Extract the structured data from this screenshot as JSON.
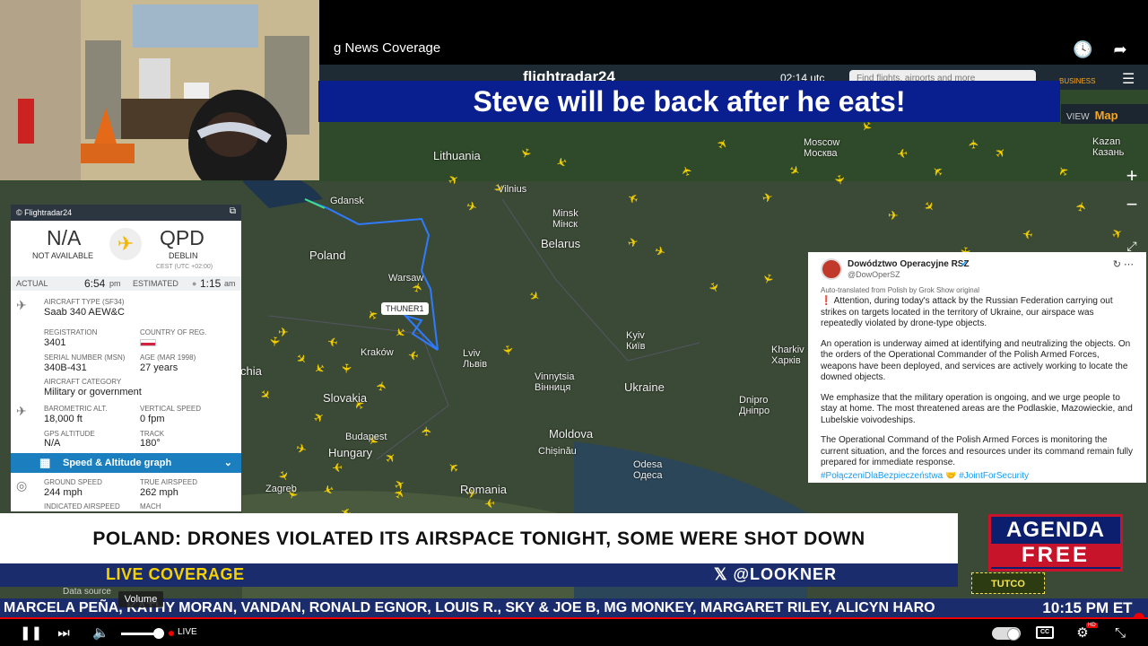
{
  "video": {
    "title_fragment": "g News Coverage",
    "banner": "Steve will be back after he eats!"
  },
  "fr24": {
    "logo": "flightradar24",
    "time": "02:14 utc",
    "search_placeholder": "Find flights, airports and more",
    "business_label": "BUSINESS",
    "view_label": "VIEW",
    "view_value": "Map",
    "zoom_in": "+",
    "zoom_out": "−"
  },
  "map_labels": [
    {
      "text": "Lithuania"
    },
    {
      "text": "Vilnius"
    },
    {
      "text": "Gdansk"
    },
    {
      "text": "Minsk\nМінск"
    },
    {
      "text": "Belarus"
    },
    {
      "text": "Moscow\nМосква"
    },
    {
      "text": "Kazan\nКазань"
    },
    {
      "text": "Poland"
    },
    {
      "text": "Warsaw"
    },
    {
      "text": "Lviv\nЛьвів"
    },
    {
      "text": "Kyiv\nКиїв"
    },
    {
      "text": "Kraków"
    },
    {
      "text": "Ukraine"
    },
    {
      "text": "Vinnytsia\nВінниця"
    },
    {
      "text": "Kharkiv\nХарків"
    },
    {
      "text": "Dnipro\nДніпро"
    },
    {
      "text": "Slovakia"
    },
    {
      "text": "Moldova"
    },
    {
      "text": "Chișinău"
    },
    {
      "text": "Odesa\nОдеса"
    },
    {
      "text": "Hungary"
    },
    {
      "text": "Budapest"
    },
    {
      "text": "Zagreb"
    },
    {
      "text": "Romania"
    },
    {
      "text": "chia"
    }
  ],
  "callout": "THUNER1",
  "panel": {
    "header": "© Flightradar24",
    "origin_code": "N/A",
    "origin_name": "NOT AVAILABLE",
    "dest_code": "QPD",
    "dest_name": "DEBLIN",
    "dest_tz": "CEST (UTC +02:00)",
    "actual_label": "ACTUAL",
    "actual_time": "6:54",
    "actual_suffix": "pm",
    "estimated_label": "ESTIMATED",
    "estimated_time": "1:15",
    "estimated_suffix": "am",
    "aircraft_type_label": "AIRCRAFT TYPE (SF34)",
    "aircraft_type": "Saab 340 AEW&C",
    "registration_label": "REGISTRATION",
    "registration": "3401",
    "country_label": "COUNTRY OF REG.",
    "serial_label": "SERIAL NUMBER (MSN)",
    "serial": "340B-431",
    "age_label": "AGE (Mar 1998)",
    "age": "27 years",
    "category_label": "AIRCRAFT CATEGORY",
    "category": "Military or government",
    "baro_label": "BAROMETRIC ALT.",
    "baro": "18,000 ft",
    "vspeed_label": "VERTICAL SPEED",
    "vspeed": "0 fpm",
    "gps_label": "GPS ALTITUDE",
    "gps": "N/A",
    "track_label": "TRACK",
    "track": "180°",
    "speed_graph": "Speed & Altitude graph",
    "ground_label": "GROUND SPEED",
    "ground": "244 mph",
    "true_label": "TRUE AIRSPEED",
    "true": "262 mph",
    "indicated_label": "INDICATED AIRSPEED",
    "mach_label": "MACH",
    "data_source": "Data source"
  },
  "tweet": {
    "name": "Dowództwo Operacyjne RSZ",
    "handle": "@DowOperSZ",
    "translated": "Auto-translated from Polish by Grok Show original",
    "p1": "❗ Attention, during today's attack by the Russian Federation carrying out strikes on targets located in the territory of Ukraine, our airspace was repeatedly violated by drone-type objects.",
    "p2": "An operation is underway aimed at identifying and neutralizing the objects. On the orders of the Operational Commander of the Polish Armed Forces, weapons have been deployed, and services are actively working to locate the downed objects.",
    "p3": "We emphasize that the military operation is ongoing, and we urge people to stay at home. The most threatened areas are the Podlaskie, Mazowieckie, and Lubelskie voivodeships.",
    "p4": "The Operational Command of the Polish Armed Forces is monitoring the current situation, and the forces and resources under its command remain fully prepared for immediate response.",
    "tags": "#PołączeniDlaBezpieczeństwa 🤝 #JointForSecurity"
  },
  "lower_third": {
    "headline": "POLAND: DRONES VIOLATED ITS AIRSPACE TONIGHT, SOME WERE SHOT DOWN",
    "live": "LIVE COVERAGE",
    "handle": "𝕏 @LOOKNER",
    "brand_top": "AGENDA",
    "brand_bottom": "FREE",
    "sponsor": "TUTCO"
  },
  "ticker": {
    "text": "MARCELA PEÑA, KATHY MORAN, VANDAN, RONALD EGNOR, LOUIS R., SKY & JOE B, MG MONKEY, MARGARET RILEY, ALICYN HARO",
    "clock": "10:15 PM ET"
  },
  "player": {
    "live_label": "LIVE",
    "volume_tooltip": "Volume",
    "cc": "CC",
    "hd": "HD"
  },
  "colors": {
    "banner": "#0a1f8f",
    "news_blue": "#1a2c6b",
    "live_yellow": "#f5d200",
    "fr_blue": "#1b7fbf",
    "progress_red": "#ee0000"
  }
}
